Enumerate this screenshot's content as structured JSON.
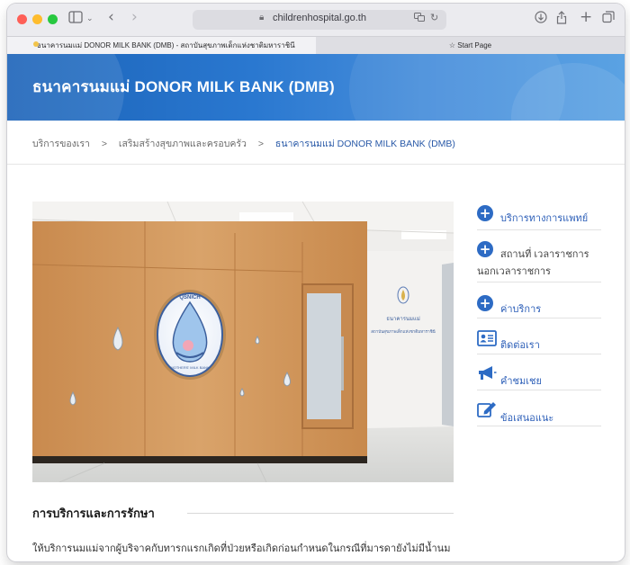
{
  "browser": {
    "url": "childrenhospital.go.th",
    "tabs": [
      {
        "label": "ธนาคารนมแม่ DONOR MILK BANK (DMB) - สถาบันสุขภาพเด็กแห่งชาติมหาราชินี"
      },
      {
        "label": "Start Page"
      }
    ]
  },
  "hero": {
    "title": "ธนาคารนมแม่ DONOR MILK BANK (DMB)"
  },
  "breadcrumb": {
    "items": [
      "บริการของเรา",
      "เสริมสร้างสุขภาพและครอบครัว",
      "ธนาคารนมแม่ DONOR MILK BANK (DMB)"
    ],
    "separator": ">"
  },
  "photo": {
    "logo_top_text": "QSNICH",
    "logo_bottom_text": "MOTHERS' MILK BANK",
    "wall_sign_line1": "ธนาคารนมแม่",
    "wall_sign_line2": "สถาบันสุขภาพเด็กแห่งชาติมหาราชินี"
  },
  "sidebar": {
    "items": [
      {
        "label": "บริการทางการแพทย์",
        "icon": "plus-circle-icon"
      },
      {
        "label_line1": "สถานที่ เวลาราชการ",
        "label_line2": "นอกเวลาราชการ",
        "icon": "plus-circle-icon"
      },
      {
        "label": "ค่าบริการ",
        "icon": "plus-circle-icon"
      },
      {
        "label": "ติดต่อเรา",
        "icon": "contact-card-icon"
      },
      {
        "label": "คำชมเชย",
        "icon": "megaphone-icon"
      },
      {
        "label": "ข้อเสนอแนะ",
        "icon": "edit-icon"
      }
    ]
  },
  "section": {
    "title": "การบริการและการรักษา",
    "paragraph": "ให้บริการนมแม่จากผู้บริจาคกับทารกแรกเกิดที่ป่วยหรือเกิดก่อนกำหนดในกรณีที่มารดายังไม่มีน้ำนม"
  },
  "colors": {
    "brand_blue": "#2d6bc4",
    "hero_blue": "#1b63b8",
    "link_blue": "#2d5fb8"
  }
}
